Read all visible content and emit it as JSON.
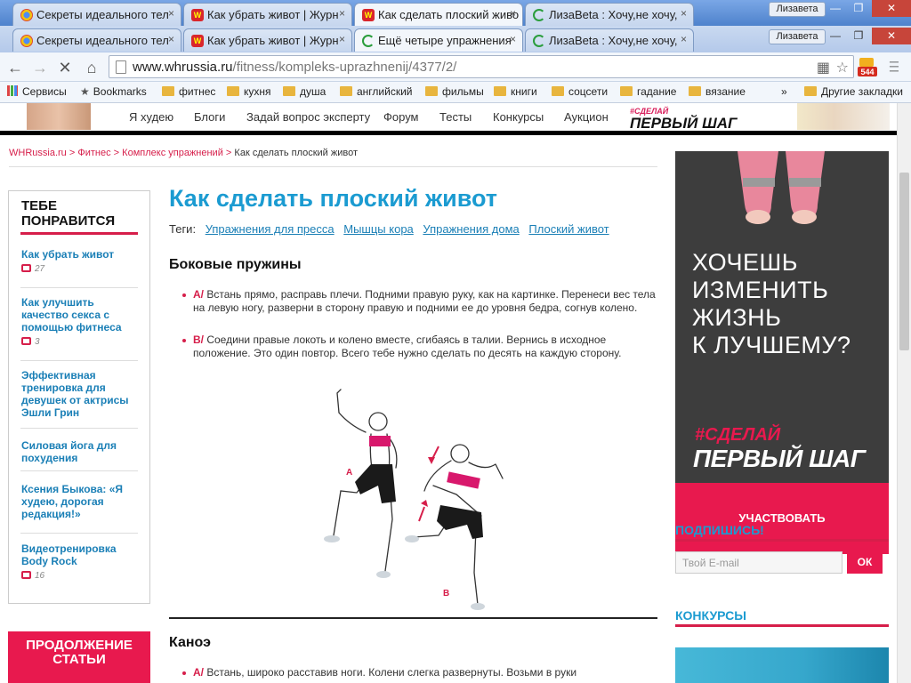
{
  "browser": {
    "tabs_row1": [
      {
        "title": "Секреты идеального тел",
        "favicon": "chrome-icon"
      },
      {
        "title": "Как убрать живот | Журн",
        "favicon": "wh-icon"
      },
      {
        "title": "Как сделать плоский живо",
        "favicon": "wh-icon"
      },
      {
        "title": "ЛизаBeta : Хочу,не хочу,",
        "favicon": "loading-icon"
      }
    ],
    "tabs_row2": [
      {
        "title": "Секреты идеального тел",
        "favicon": "chrome-icon"
      },
      {
        "title": "Как убрать живот | Журн",
        "favicon": "wh-icon"
      },
      {
        "title": "Ещё четыре упражнения",
        "favicon": "loading-icon"
      },
      {
        "title": "ЛизаBeta : Хочу,не хочу,",
        "favicon": "loading-icon"
      }
    ],
    "close_glyph": "×",
    "profile_name": "Лизавета",
    "url_domain": "www.whrussia.ru",
    "url_path": "/fitness/kompleks-uprazhnenij/4377/2/",
    "extension_badge": "544",
    "bookmarks": [
      {
        "label": "Сервисы",
        "icon": "apps-icon"
      },
      {
        "label": "Bookmarks",
        "icon": "star-icon"
      },
      {
        "label": "фитнес",
        "icon": "folder-icon"
      },
      {
        "label": "кухня",
        "icon": "folder-icon"
      },
      {
        "label": "душа",
        "icon": "folder-icon"
      },
      {
        "label": "английский",
        "icon": "folder-icon"
      },
      {
        "label": "фильмы",
        "icon": "folder-icon"
      },
      {
        "label": "книги",
        "icon": "folder-icon"
      },
      {
        "label": "соцсети",
        "icon": "folder-icon"
      },
      {
        "label": "гадание",
        "icon": "folder-icon"
      },
      {
        "label": "вязание",
        "icon": "folder-icon"
      }
    ],
    "bookmarks_more": "»",
    "other_bookmarks": "Другие закладки"
  },
  "site": {
    "nav": [
      "Я худею",
      "Блоги",
      "Задай вопрос эксперту",
      "Форум",
      "Тесты",
      "Конкурсы",
      "Аукцион"
    ],
    "nav_promo_tag": "#СДЕЛАЙ",
    "nav_promo": "ПЕРВЫЙ ШАГ",
    "breadcrumbs": [
      "WHRussia.ru",
      "Фитнес",
      "Комплекс упражнений",
      "Как сделать плоский живот"
    ],
    "crumb_sep": ">",
    "sidebar": {
      "title": "ТЕБЕ ПОНРАВИТСЯ",
      "items": [
        {
          "title": "Как убрать живот",
          "comments": "27"
        },
        {
          "title": "Как улучшить качество секса с помощью фитнеса",
          "comments": "3"
        },
        {
          "title": "Эффективная тренировка для девушек от актрисы Эшли Грин",
          "comments": ""
        },
        {
          "title": "Силовая йога для похудения",
          "comments": ""
        },
        {
          "title": "Ксения Быкова: «Я худею, дорогая редакция!»",
          "comments": ""
        },
        {
          "title": "Видеотренировка Body Rock",
          "comments": "16"
        }
      ],
      "promo": "ПРОДОЛЖЕНИЕ СТАТЬИ"
    },
    "article": {
      "title": "Как сделать плоский живот",
      "tags_label": "Теги:",
      "tags": [
        "Упражнения для пресса",
        "Мышцы кора",
        "Упражнения дома",
        "Плоский живот"
      ],
      "section1_title": "Боковые пружины",
      "step_a_label": "А/",
      "step_a": "Встань прямо, расправь плечи. Подними правую руку, как на картинке. Перенеси вес тела на левую ногу, разверни в сторону правую и подними ее до уровня бедра, согнув колено.",
      "step_b_label": "В/",
      "step_b": "Соедини правые локоть и колено вместе, сгибаясь в талии. Вернись в исходное положение. Это один повтор. Всего тебе нужно сделать по десять на каждую сторону.",
      "figure_a": "A",
      "figure_b": "B",
      "section2_title": "Каноэ",
      "step2_a_label": "А/",
      "step2_a": "Встань, широко расставив ноги. Колени слегка развернуты. Возьми в руки"
    },
    "ad": {
      "headline_lines": [
        "ХОЧЕШЬ",
        "ИЗМЕНИТЬ",
        "ЖИЗНЬ",
        "К ЛУЧШЕМУ?"
      ],
      "tag": "#СДЕЛАЙ",
      "brand": "ПЕРВЫЙ ШАГ",
      "cta": "УЧАСТВОВАТЬ"
    },
    "subscribe": {
      "title": "ПОДПИШИСЬ!",
      "placeholder": "Твой E-mail",
      "button": "ОК"
    },
    "contests_title": "КОНКУРСЫ"
  },
  "colors": {
    "accent": "#d61e4a",
    "link": "#1b9bd1",
    "promo": "#e8194e"
  }
}
